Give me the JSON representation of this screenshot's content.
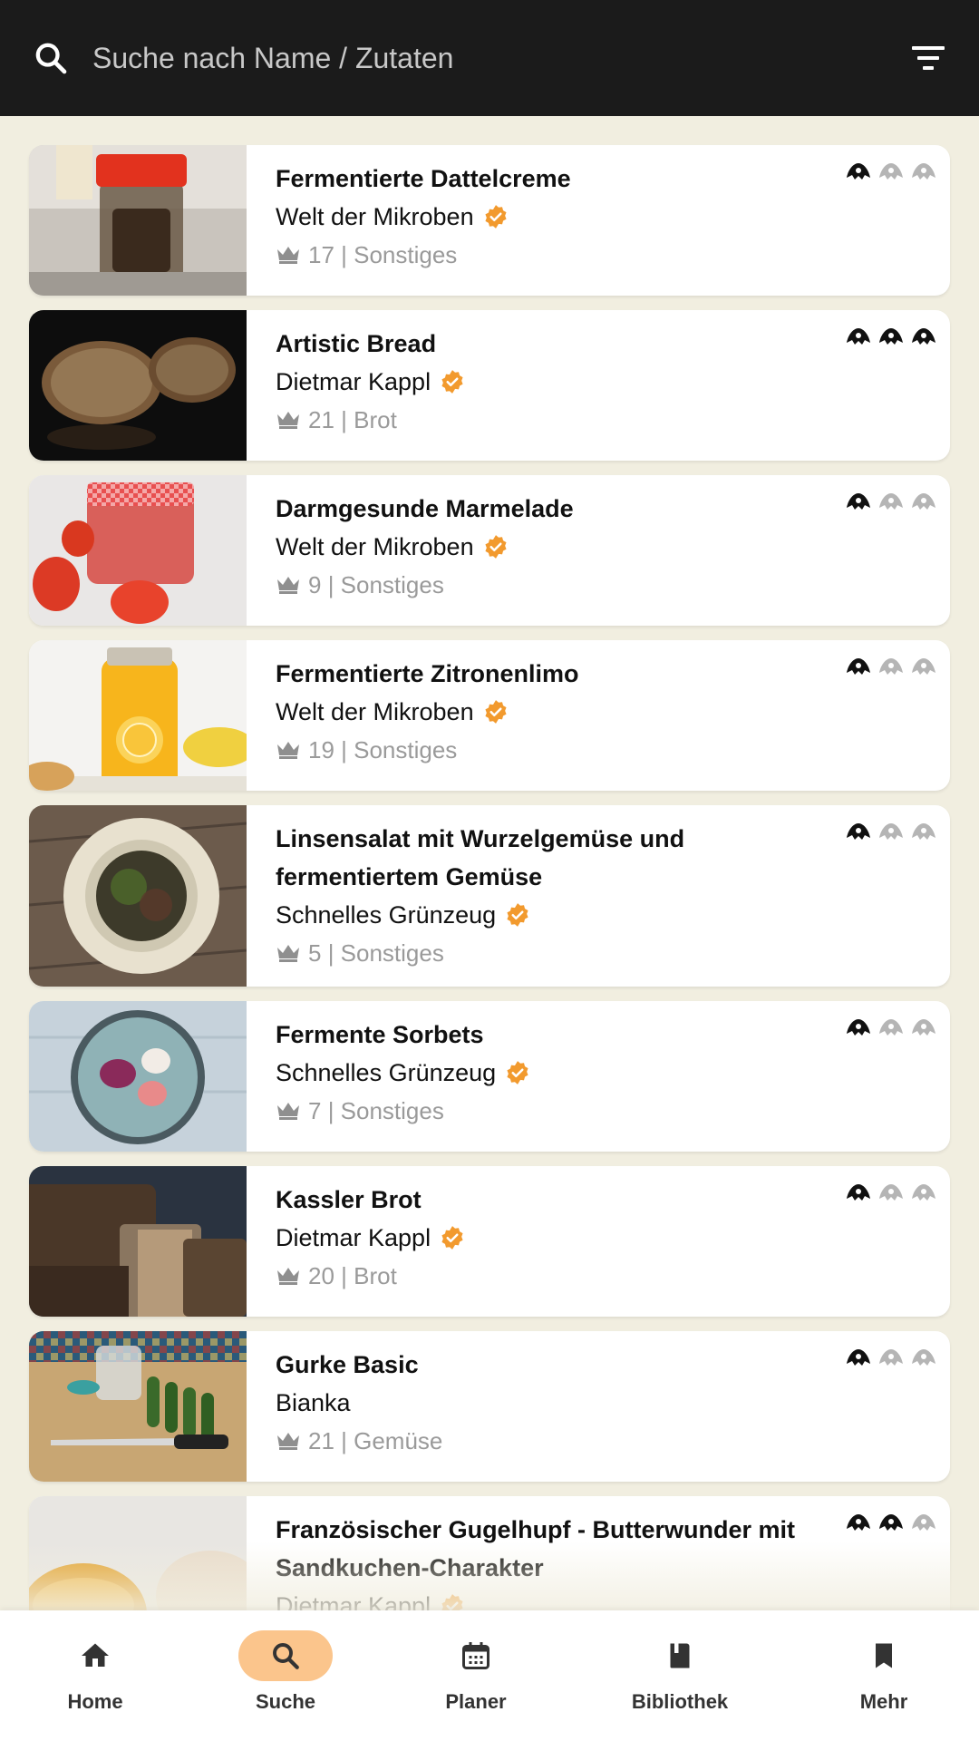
{
  "header": {
    "search_placeholder": "Suche nach Name / Zutaten",
    "search_icon": "search-icon",
    "filter_icon": "filter-icon"
  },
  "recipes": [
    {
      "title": "Fermentierte Dattelcreme",
      "author": "Welt der Mikroben",
      "verified": true,
      "count": "17",
      "category": "Sonstiges",
      "difficulty": 1
    },
    {
      "title": "Artistic Bread",
      "author": "Dietmar Kappl",
      "verified": true,
      "count": "21",
      "category": "Brot",
      "difficulty": 3
    },
    {
      "title": "Darmgesunde Marmelade",
      "author": "Welt der Mikroben",
      "verified": true,
      "count": "9",
      "category": "Sonstiges",
      "difficulty": 1
    },
    {
      "title": "Fermentierte Zitronenlimo",
      "author": "Welt der Mikroben",
      "verified": true,
      "count": "19",
      "category": "Sonstiges",
      "difficulty": 1
    },
    {
      "title": "Linsensalat mit Wurzelgemüse und fermentiertem Gemüse",
      "author": "Schnelles Grünzeug",
      "verified": true,
      "count": "5",
      "category": "Sonstiges",
      "difficulty": 1
    },
    {
      "title": "Fermente Sorbets",
      "author": "Schnelles Grünzeug",
      "verified": true,
      "count": "7",
      "category": "Sonstiges",
      "difficulty": 1
    },
    {
      "title": "Kassler Brot",
      "author": "Dietmar Kappl",
      "verified": true,
      "count": "20",
      "category": "Brot",
      "difficulty": 1
    },
    {
      "title": "Gurke Basic",
      "author": "Bianka",
      "verified": false,
      "count": "21",
      "category": "Gemüse",
      "difficulty": 1
    },
    {
      "title": "Französischer Gugelhupf - Butterwunder mit Sandkuchen-Charakter",
      "author": "Dietmar Kappl",
      "verified": true,
      "count": "",
      "category": "",
      "difficulty": 2
    }
  ],
  "nav": {
    "items": [
      {
        "label": "Home",
        "icon": "home-icon",
        "active": false
      },
      {
        "label": "Suche",
        "icon": "search-icon",
        "active": true
      },
      {
        "label": "Planer",
        "icon": "calendar-icon",
        "active": false
      },
      {
        "label": "Bibliothek",
        "icon": "book-icon",
        "active": false
      },
      {
        "label": "Mehr",
        "icon": "bookmark-icon",
        "active": false
      }
    ]
  },
  "colors": {
    "header_bg": "#1b1b1b",
    "page_bg": "#f1eee0",
    "verified": "#f29a2e",
    "active_nav": "#fbc58c"
  }
}
